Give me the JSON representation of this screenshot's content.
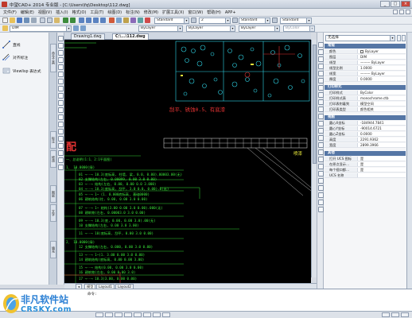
{
  "window": {
    "title": "中望CAD+ 2014 专业版 - [C:\\Users\\fq\\Desktop\\112.dwg]",
    "controls": [
      "_",
      "□",
      "×"
    ]
  },
  "menu": {
    "items": [
      "文件(F)",
      "编辑(E)",
      "视图(V)",
      "插入(I)",
      "格式(O)",
      "工具(T)",
      "绘图(D)",
      "标注(N)",
      "修改(M)",
      "扩展工具(X)",
      "窗口(W)",
      "帮助(H)",
      "APP+"
    ]
  },
  "toolbar1": {
    "dim_style": "Standard",
    "text_style": "Standard",
    "table_style": "Standard",
    "scale": "2"
  },
  "toolbar2": {
    "layer": "DIM",
    "color": "ByLayer",
    "linetype": "ByLayer",
    "lineweight": "ByLayer",
    "plot_style": "ByColor"
  },
  "left_panel": {
    "items": [
      {
        "label": "直线",
        "icon": "line-tool-icon"
      },
      {
        "label": "对齐标注",
        "icon": "aligned-dimension-icon"
      },
      {
        "label": "Viewlisp 表达式",
        "icon": "lisp-expression-icon"
      }
    ],
    "palette_tabs": [
      "命令工具",
      "标注",
      "修改",
      "图层",
      "文字",
      "填充"
    ]
  },
  "doc_tabs": {
    "tabs": [
      {
        "label": "Drawing1.dwg",
        "active": false
      },
      {
        "label": "C:\\...\\112.dwg",
        "active": true
      }
    ]
  },
  "canvas": {
    "red_note": "刮平、锈蚀0.5、有底漆",
    "big_char": "配",
    "yellow_note": "喷漆",
    "lines": [
      "一、总说明(1:1、2:1平面图)",
      "1、 10.0000(绿)",
      "01 →--→ 10.3(底标高, 柱墙, 梁, 0.0, 0.00).00003.00(无)",
      "02  支撑结构(左右, 0.00099, 0.00 3.0 0.00)",
      "03 →--→ 结构(左右, 0.00, 0.00 0.0 3.000)",
      "04 →--→ 10.3(底标高, 刮平, 3.0 0.0, 0.00).0(无)",
      "05 →--→ 1~ (1. 0.000底标高, 基础0000)",
      "06  建筑结构(柱, 0.00, 0.00 3.0 0.00)",
      "07 →--→ 1~ 结构(3.00 0.00 3.0 0.00).000(无)",
      "08  建筑物(左右, 0.00003.0 3.0 0.00)",
      "09 →--→ 10.3(底, 0.00, 0.00 3.0).00(无)",
      "10  支撑结构(左右, 0.00 3.0 3.00)",
      "11 →--→ 10(底标高, 刮平, 0.00 3.0 0.00)",
      "2、 10.0000(绿)",
      "12  支撑结构(左右, 0.000, 0.00 3.0 0.00)",
      "13 →--→ 1~(1. 3.00 0.00 3.0 0.00)",
      "14  建筑结构(底标高, 0.00 0.00 3.00)",
      "15 →--→ 结构(0.00, 0.00 3.0 0.00)",
      "16  建筑物(左右, 0.00 0.00 3.0)",
      "17 →--→ 10.3(3.00, 0.00 0.00)",
      "18 →--→ 结构(左右, 0.00 0.00 3.0)"
    ]
  },
  "layout_tabs": [
    "模型",
    "Layout1",
    "Layout2"
  ],
  "properties": {
    "selector": "无选择",
    "sections": [
      {
        "title": "常规",
        "rows": [
          {
            "k": "颜色",
            "v": "ByLayer",
            "swatch": "#ffffff"
          },
          {
            "k": "图层",
            "v": "DIM"
          },
          {
            "k": "线型",
            "v": "——— ByLayer"
          },
          {
            "k": "线型比例",
            "v": "1.0000"
          },
          {
            "k": "线宽",
            "v": "——— ByLayer"
          },
          {
            "k": "厚度",
            "v": "0.0000"
          }
        ]
      },
      {
        "title": "打印样式",
        "rows": [
          {
            "k": "打印样式",
            "v": "ByColor"
          },
          {
            "k": "打印样式表",
            "v": "monochrome.ctb"
          },
          {
            "k": "打印表附着到",
            "v": "模型空间"
          },
          {
            "k": "打印表类型",
            "v": "颜色相关"
          }
        ]
      },
      {
        "title": "视图",
        "rows": [
          {
            "k": "圆心X坐标",
            "v": "-184944.7841"
          },
          {
            "k": "圆心Y坐标",
            "v": "-90014.6721"
          },
          {
            "k": "圆心Z坐标",
            "v": "0.0000"
          },
          {
            "k": "高度",
            "v": "2291.9362"
          },
          {
            "k": "宽度",
            "v": "2899.3966"
          }
        ]
      },
      {
        "title": "其他",
        "rows": [
          {
            "k": "打开 UCS 图标",
            "v": "是"
          },
          {
            "k": "在原点显示…",
            "v": "是"
          },
          {
            "k": "每个视口都…",
            "v": "是"
          },
          {
            "k": "UCS 名称",
            "v": ""
          }
        ]
      }
    ]
  },
  "command": {
    "prompt": "命令:"
  },
  "watermark": {
    "name": "非凡软件站",
    "domain": "CRSKY.com"
  },
  "colors": {
    "canvas_bg": "#000000",
    "cad_green": "#3be83b",
    "cad_red": "#e33333",
    "cad_cyan": "#2fd6e8",
    "cad_yellow": "#e8e83b",
    "section_header": "#5576a5"
  }
}
